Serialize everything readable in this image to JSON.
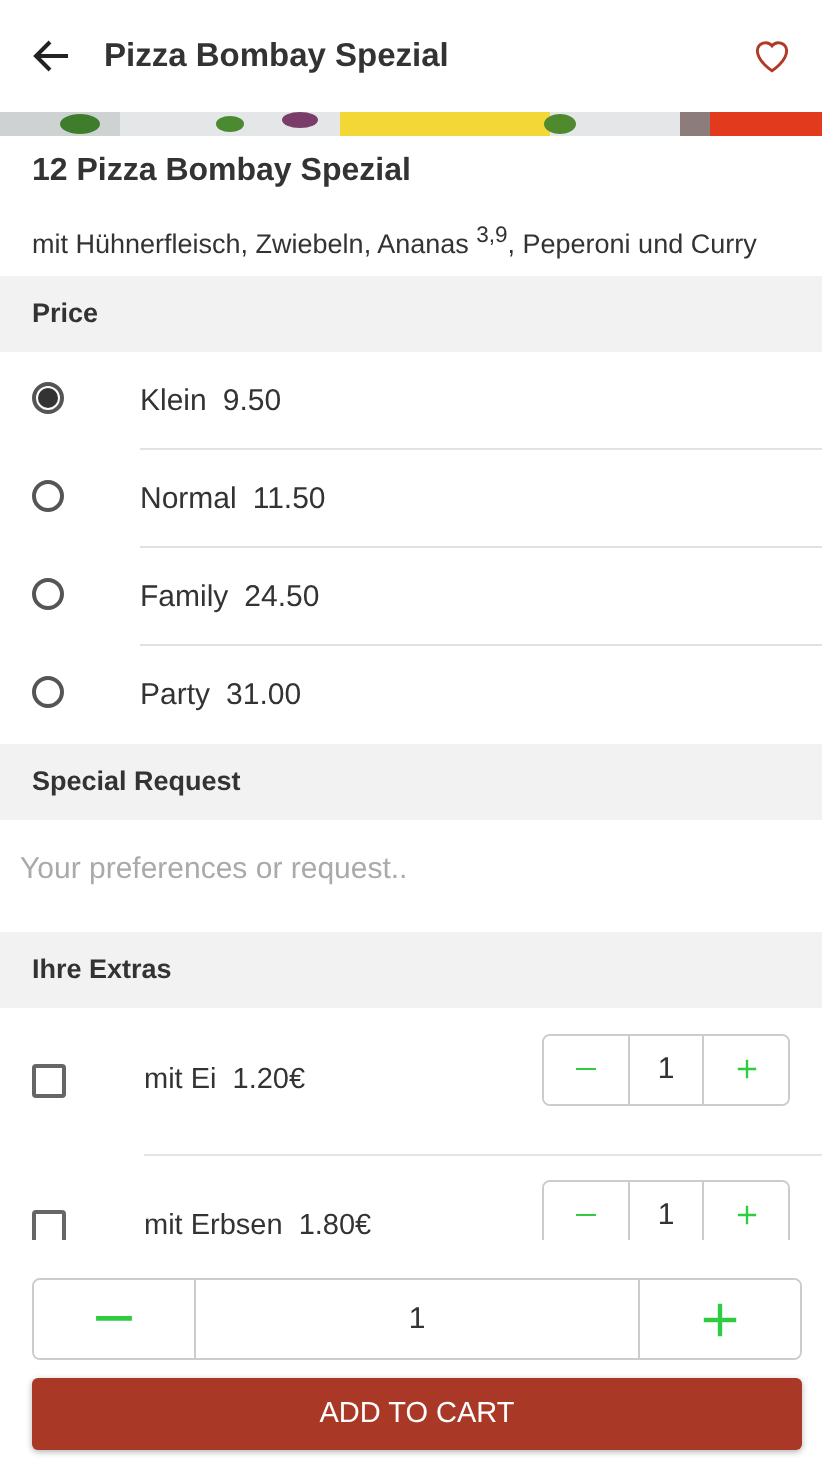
{
  "header": {
    "title": "Pizza Bombay Spezial",
    "favorite": false
  },
  "product": {
    "kind": "picture",
    "name": "12 Pizza Bombay Spezial",
    "description": "mit Hühnerfleisch, Zwiebeln, Ananas $^{3,9}$, Peperoni und Curry"
  },
  "price_section": {
    "title": "Price",
    "options": [
      {
        "label": "Klein",
        "price": "9.50",
        "selected": true
      },
      {
        "label": "Normal",
        "price": "11.50",
        "selected": false
      },
      {
        "label": "Family",
        "price": "24.50",
        "selected": false
      },
      {
        "label": "Party",
        "price": "31.00",
        "selected": false
      }
    ]
  },
  "special_request": {
    "title": "Special Request",
    "placeholder": "Your preferences or request.."
  },
  "extras": {
    "title": "Ihre Extras",
    "items": [
      {
        "label": "mit Ei",
        "price": "1.20€",
        "checked": false,
        "quantity": "1"
      },
      {
        "label": "mit Erbsen",
        "price": "1.80€",
        "checked": false,
        "quantity": "1"
      }
    ]
  },
  "footer": {
    "quantity": "1",
    "add_button": "ADD TO CART"
  }
}
